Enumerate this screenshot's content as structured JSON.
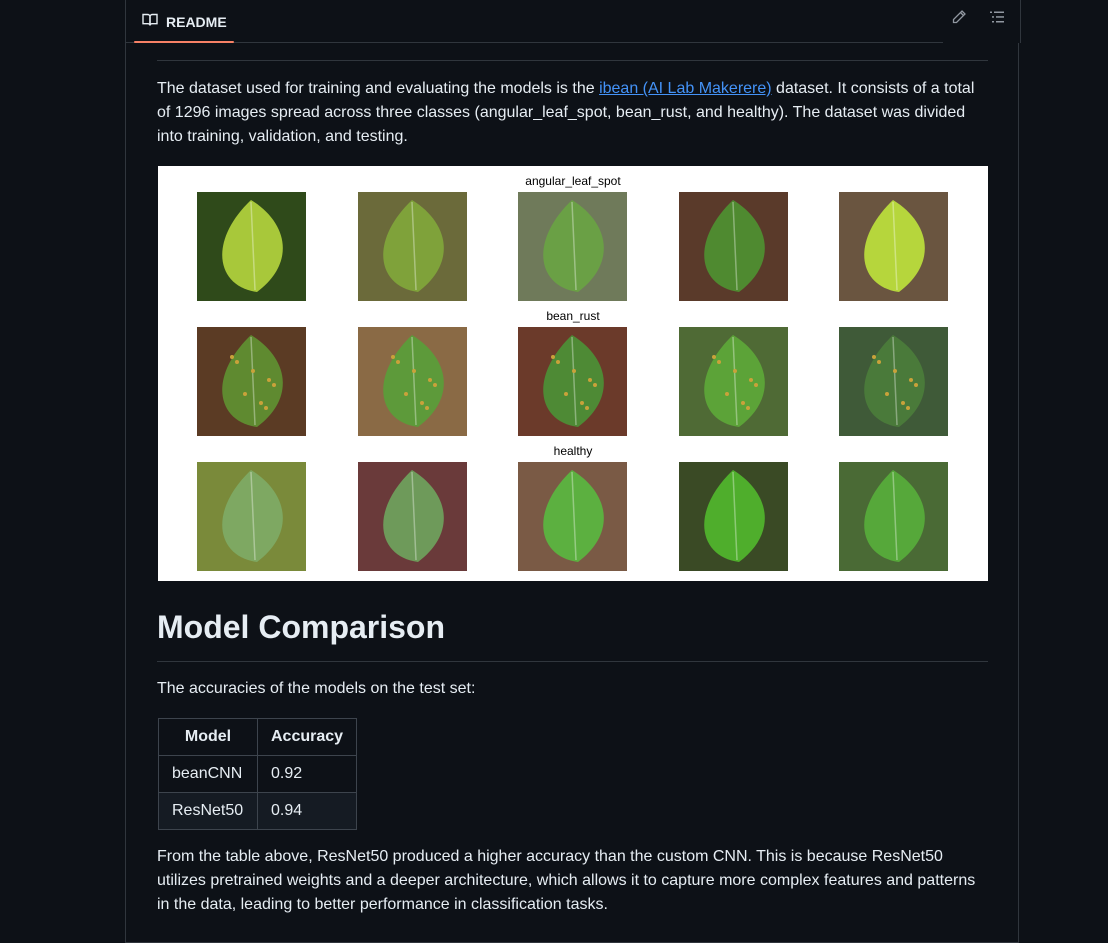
{
  "tab": {
    "label": "README"
  },
  "intro": {
    "before_link": "The dataset used for training and evaluating the models is the ",
    "link_text": "ibean (AI Lab Makerere)",
    "after_link": " dataset. It consists of a total of 1296 images spread across three classes (angular_leaf_spot, bean_rust, and healthy). The dataset was divided into training, validation, and testing."
  },
  "figure": {
    "row_titles": [
      "angular_leaf_spot",
      "bean_rust",
      "healthy"
    ]
  },
  "heading": "Model Comparison",
  "accuracy_intro": "The accuracies of the models on the test set:",
  "table": {
    "headers": [
      "Model",
      "Accuracy"
    ],
    "rows": [
      [
        "beanCNN",
        "0.92"
      ],
      [
        "ResNet50",
        "0.94"
      ]
    ]
  },
  "conclusion": "From the table above, ResNet50 produced a higher accuracy than the custom CNN. This is because ResNet50 utilizes pretrained weights and a deeper architecture, which allows it to capture more complex features and patterns in the data, leading to better performance in classification tasks.",
  "icons": {
    "book": "book-icon",
    "edit": "pencil-icon",
    "outline": "list-icon"
  },
  "colors": {
    "background": "#0d1117",
    "text": "#e6edf3",
    "link": "#4493f8",
    "tab_underline": "#f78166",
    "border": "#30363d"
  }
}
